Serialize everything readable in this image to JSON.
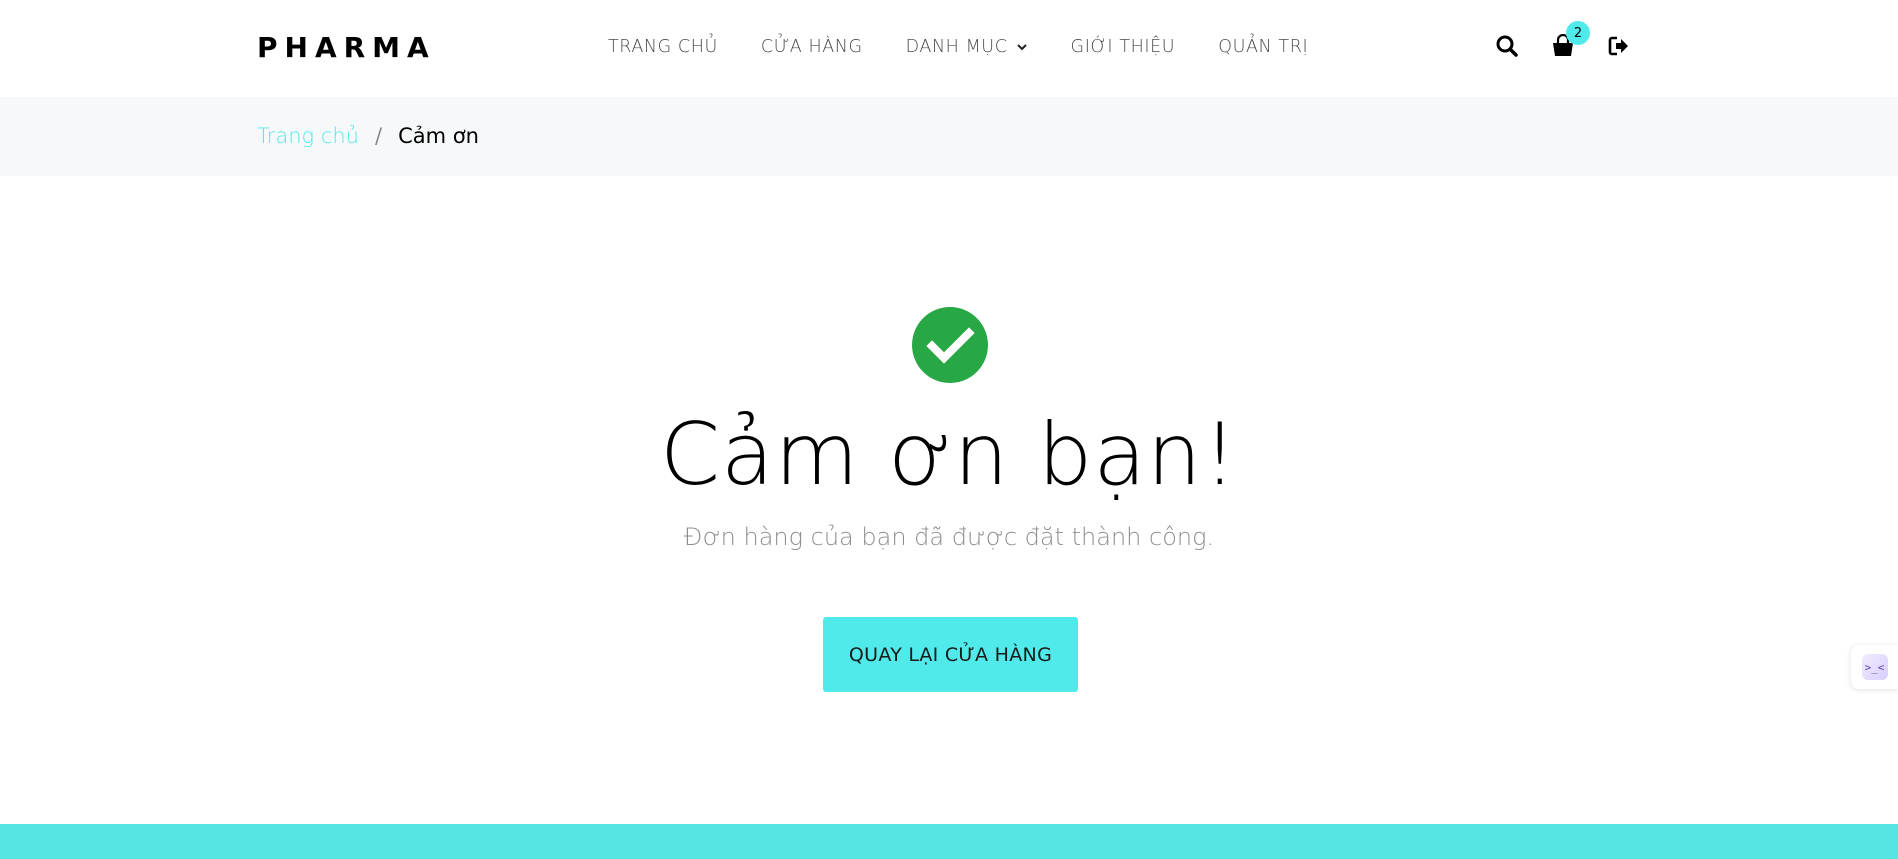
{
  "header": {
    "logo": "PHARMA",
    "nav": [
      {
        "label": "TRANG CHỦ"
      },
      {
        "label": "CỬA HÀNG"
      },
      {
        "label": "DANH MỤC"
      },
      {
        "label": "GIỚI THIỆU"
      },
      {
        "label": "QUẢN TRỊ"
      }
    ],
    "cart_count": "2",
    "icons": [
      "search-icon",
      "shopping-bag-icon",
      "sign-out-icon"
    ]
  },
  "breadcrumb": {
    "home": "Trang chủ",
    "separator": "/",
    "current": "Cảm ơn"
  },
  "main": {
    "icon": "check-circle-icon",
    "title": "Cảm ơn bạn!",
    "subtitle": "Đơn hàng của bạn đã được đặt thành công.",
    "button_label": "QUAY LẠI CỬA HÀNG"
  },
  "side_widget": {
    "text": ">_<"
  },
  "colors": {
    "accent": "#51eaea",
    "success": "#28a745",
    "breadcrumb_bg": "#f7f8f9"
  }
}
